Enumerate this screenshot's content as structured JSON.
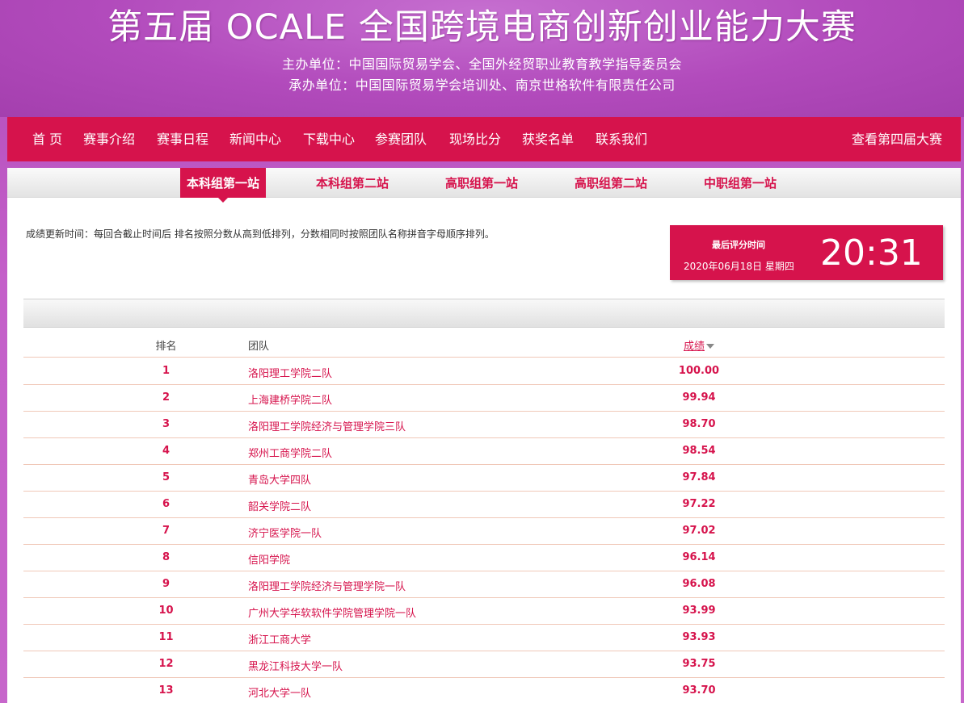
{
  "banner": {
    "title": "第五届 OCALE 全国跨境电商创新创业能力大赛",
    "organizer": "主办单位：中国国际贸易学会、全国外经贸职业教育教学指导委员会",
    "host": "承办单位：中国国际贸易学会培训处、南京世格软件有限责任公司"
  },
  "nav": {
    "items": [
      "首 页",
      "赛事介绍",
      "赛事日程",
      "新闻中心",
      "下载中心",
      "参赛团队",
      "现场比分",
      "获奖名单",
      "联系我们"
    ],
    "right": "查看第四届大赛"
  },
  "tabs": [
    "本科组第一站",
    "本科组第二站",
    "高职组第一站",
    "高职组第二站",
    "中职组第一站"
  ],
  "note": "成绩更新时间：每回合截止时间后 排名按照分数从高到低排列，分数相同时按照团队名称拼音字母顺序排列。",
  "timebox": {
    "label": "最后评分时间",
    "date": "2020年06月18日 星期四",
    "clock": "20:31"
  },
  "table": {
    "headers": {
      "rank": "排名",
      "team": "团队",
      "score": "成绩"
    },
    "rows": [
      {
        "rank": "1",
        "team": "洛阳理工学院二队",
        "score": "100.00"
      },
      {
        "rank": "2",
        "team": "上海建桥学院二队",
        "score": "99.94"
      },
      {
        "rank": "3",
        "team": "洛阳理工学院经济与管理学院三队",
        "score": "98.70"
      },
      {
        "rank": "4",
        "team": "郑州工商学院二队",
        "score": "98.54"
      },
      {
        "rank": "5",
        "team": "青岛大学四队",
        "score": "97.84"
      },
      {
        "rank": "6",
        "team": "韶关学院二队",
        "score": "97.22"
      },
      {
        "rank": "7",
        "team": "济宁医学院一队",
        "score": "97.02"
      },
      {
        "rank": "8",
        "team": "信阳学院",
        "score": "96.14"
      },
      {
        "rank": "9",
        "team": "洛阳理工学院经济与管理学院一队",
        "score": "96.08"
      },
      {
        "rank": "10",
        "team": "广州大学华软软件学院管理学院一队",
        "score": "93.99"
      },
      {
        "rank": "11",
        "team": "浙江工商大学",
        "score": "93.93"
      },
      {
        "rank": "12",
        "team": "黑龙江科技大学一队",
        "score": "93.75"
      },
      {
        "rank": "13",
        "team": "河北大学一队",
        "score": "93.70"
      }
    ]
  }
}
